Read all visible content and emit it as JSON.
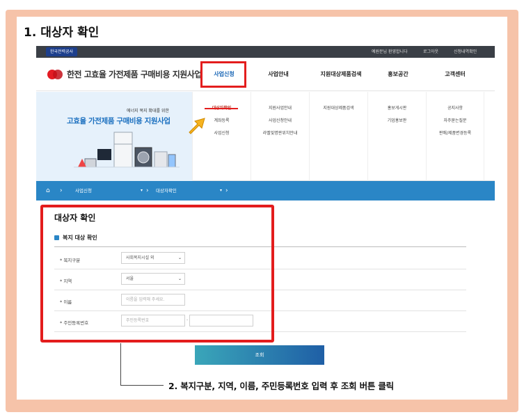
{
  "annotations": {
    "step1": "1. 대상자 확인",
    "step2": "2. 복지구분, 지역, 이름, 주민등록번호 입력 후 조회 버튼 클릭"
  },
  "topbar": {
    "brand": "한국전력공사",
    "welcome": "예원문님 환영합니다",
    "logout": "로그아웃",
    "my_apply": "신청내역확인"
  },
  "header": {
    "logo_text": "한전 고효율 가전제품 구매비용 지원사업",
    "nav": [
      "사업신청",
      "사업안내",
      "지원대상제품검색",
      "홍보공간",
      "고객센터"
    ]
  },
  "banner": {
    "small": "에너지 복지 확대를 위한",
    "big": "고효율 가전제품 구매비용 지원사업"
  },
  "submenu": {
    "col1": [
      "대상자확인",
      "계좌등록",
      "사업신청"
    ],
    "col2": [
      "지원사업안내",
      "사업신청안내",
      "라벨및명판위치안내"
    ],
    "col3": [
      "지원대상제품검색"
    ],
    "col4": [
      "홍보게시판",
      "기업홍보판"
    ],
    "col5": [
      "공지사항",
      "자주묻는질문",
      "판매/제품변경등록"
    ]
  },
  "breadcrumb": {
    "level1": "사업신청",
    "level2": "대상자확인"
  },
  "form": {
    "title": "대상자 확인",
    "section": "복지 대상 확인",
    "welfare_label": "* 복지구분",
    "welfare_value": "사회복지시설 외",
    "region_label": "* 지역",
    "region_value": "서울",
    "name_label": "* 이름",
    "name_placeholder": "이름을 입력해 주세요.",
    "rrn_label": "* 주민등록번호",
    "rrn_placeholder": "주민등록번호",
    "rrn_dash": "-",
    "submit": "조회"
  },
  "colors": {
    "highlight": "#e31d1d",
    "accent_blue": "#2a86c6",
    "frame": "#f6c3a9"
  }
}
